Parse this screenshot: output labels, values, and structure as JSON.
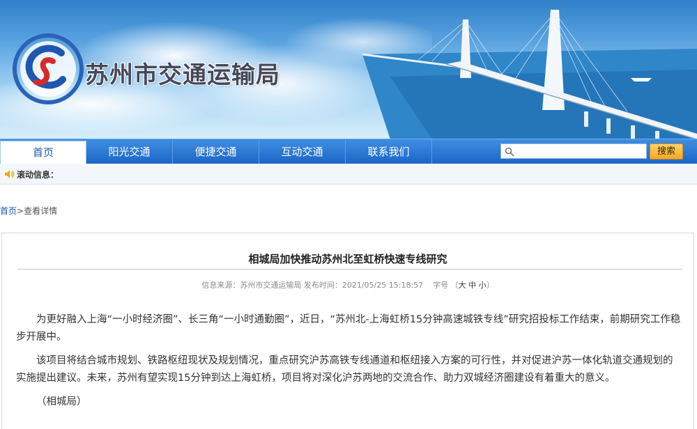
{
  "header": {
    "site_title": "苏州市交通运输局"
  },
  "nav": {
    "items": [
      {
        "label": "首页",
        "active": true
      },
      {
        "label": "阳光交通",
        "active": false
      },
      {
        "label": "便捷交通",
        "active": false
      },
      {
        "label": "互动交通",
        "active": false
      },
      {
        "label": "联系我们",
        "active": false
      }
    ],
    "search": {
      "value": "",
      "placeholder": ""
    },
    "search_button": "搜索"
  },
  "scroll_info": {
    "label": "滚动信息："
  },
  "breadcrumb": {
    "home": "首页",
    "separator": ">",
    "current": "查看详情"
  },
  "article": {
    "title": "相城局加快推动苏州北至虹桥快速专线研究",
    "meta": {
      "source_label": "信息来源：",
      "source": "苏州市交通运输局",
      "date_label": "发布时间：",
      "date": "2021/05/25 15:18:57",
      "font_label": "字号",
      "bracket_open": "〔",
      "size_large": "大",
      "size_medium": "中",
      "size_small": "小",
      "bracket_close": "〕"
    },
    "paragraphs": [
      "为更好融入上海“一小时经济圈”、长三角“一小时通勤圈”，近日，“苏州北-上海虹桥15分钟高速城铁专线”研究招投标工作结束，前期研究工作稳步开展中。",
      "该项目将结合城市规划、铁路枢纽现状及规划情况，重点研究沪苏高铁专线通道和枢纽接入方案的可行性，并对促进沪苏一体化轨道交通规划的实施提出建议。未来，苏州有望实现15分钟到达上海虹桥，项目将对深化沪苏两地的交流合作、助力双城经济圈建设有着重大的意义。",
      "（相城局）"
    ]
  },
  "colors": {
    "nav_blue": "#1c66c6",
    "link_blue": "#1b58b5",
    "search_button_orange": "#f5a623"
  }
}
